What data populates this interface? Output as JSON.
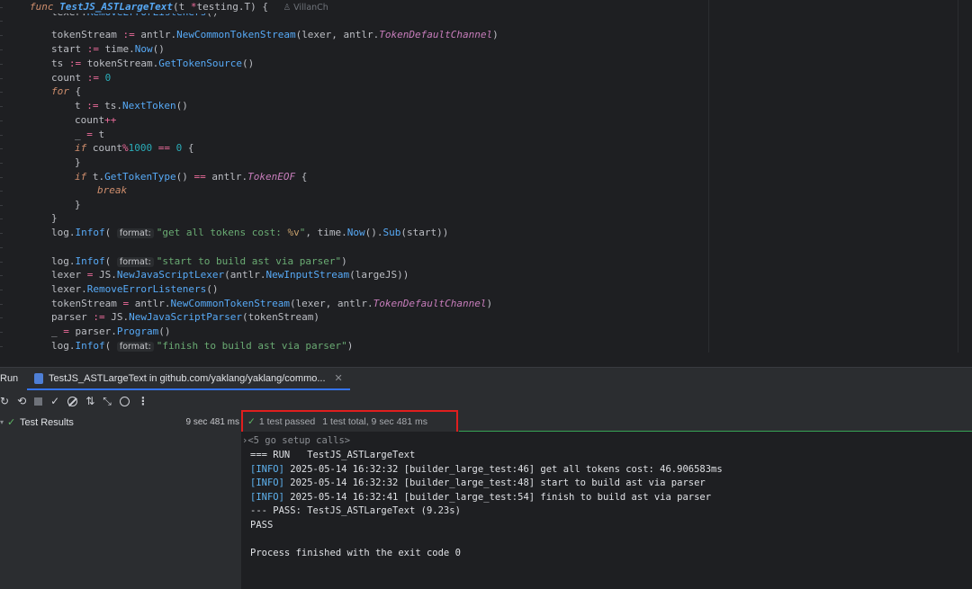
{
  "editor": {
    "lines": [
      {
        "parts": [
          [
            "kw",
            "func "
          ],
          [
            "fnd",
            "TestJS_ASTLargeText"
          ],
          [
            "brace",
            "("
          ],
          [
            "var",
            "t "
          ],
          [
            "op",
            "*"
          ],
          [
            "pkg",
            "testing"
          ],
          [
            "brace",
            "."
          ],
          [
            "ty",
            "T"
          ],
          [
            "brace",
            ") { "
          ]
        ],
        "author": "VillanCh"
      },
      {
        "parts": [
          [
            "var",
            "lexer."
          ],
          [
            "call",
            "RemoveErrorListeners"
          ],
          [
            "brace",
            "()"
          ]
        ]
      },
      {
        "parts": [
          [
            "var",
            "tokenStream "
          ],
          [
            "op",
            ":= "
          ],
          [
            "var",
            "antlr."
          ],
          [
            "call",
            "NewCommonTokenStream"
          ],
          [
            "brace",
            "("
          ],
          [
            "var",
            "lexer, antlr."
          ],
          [
            "tyi",
            "TokenDefaultChannel"
          ],
          [
            "brace",
            ")"
          ]
        ]
      },
      {
        "parts": [
          [
            "var",
            "start "
          ],
          [
            "op",
            ":= "
          ],
          [
            "var",
            "time."
          ],
          [
            "call",
            "Now"
          ],
          [
            "brace",
            "()"
          ]
        ]
      },
      {
        "parts": [
          [
            "var",
            "ts "
          ],
          [
            "op",
            ":= "
          ],
          [
            "var",
            "tokenStream."
          ],
          [
            "call",
            "GetTokenSource"
          ],
          [
            "brace",
            "()"
          ]
        ]
      },
      {
        "parts": [
          [
            "var",
            "count "
          ],
          [
            "op",
            ":= "
          ],
          [
            "num",
            "0"
          ]
        ]
      },
      {
        "parts": [
          [
            "kw",
            "for "
          ],
          [
            "brace",
            "{"
          ]
        ]
      },
      {
        "parts": [
          [
            "var",
            "t "
          ],
          [
            "op",
            ":= "
          ],
          [
            "var",
            "ts."
          ],
          [
            "call",
            "NextToken"
          ],
          [
            "brace",
            "()"
          ]
        ]
      },
      {
        "parts": [
          [
            "var",
            "count"
          ],
          [
            "op",
            "++"
          ]
        ]
      },
      {
        "parts": [
          [
            "var",
            "_ "
          ],
          [
            "op",
            "= "
          ],
          [
            "var",
            "t"
          ]
        ]
      },
      {
        "parts": [
          [
            "kw",
            "if "
          ],
          [
            "var",
            "count"
          ],
          [
            "op",
            "%"
          ],
          [
            "num",
            "1000 "
          ],
          [
            "op",
            "== "
          ],
          [
            "num",
            "0 "
          ],
          [
            "brace",
            "{"
          ]
        ]
      },
      {
        "parts": [
          [
            "brace",
            "}"
          ]
        ]
      },
      {
        "parts": [
          [
            "kw",
            "if "
          ],
          [
            "var",
            "t."
          ],
          [
            "call",
            "GetTokenType"
          ],
          [
            "brace",
            "() "
          ],
          [
            "op",
            "== "
          ],
          [
            "var",
            "antlr."
          ],
          [
            "tyi",
            "TokenEOF "
          ],
          [
            "brace",
            "{"
          ]
        ]
      },
      {
        "parts": [
          [
            "kw",
            "break"
          ]
        ]
      },
      {
        "parts": [
          [
            "brace",
            "}"
          ]
        ]
      },
      {
        "parts": [
          [
            "brace",
            "}"
          ]
        ]
      },
      {
        "parts": [
          [
            "var",
            "log."
          ],
          [
            "call",
            "Infof"
          ],
          [
            "brace",
            "( "
          ],
          [
            "hint",
            "format:"
          ],
          [
            "str",
            "\"get all tokens cost: "
          ],
          [
            "fmt",
            "%v"
          ],
          [
            "str",
            "\""
          ],
          [
            "brace",
            ", time."
          ],
          [
            "call",
            "Now"
          ],
          [
            "brace",
            "()."
          ],
          [
            "call",
            "Sub"
          ],
          [
            "brace",
            "(start))"
          ]
        ]
      },
      {
        "parts": []
      },
      {
        "parts": [
          [
            "var",
            "log."
          ],
          [
            "call",
            "Infof"
          ],
          [
            "brace",
            "( "
          ],
          [
            "hint",
            "format:"
          ],
          [
            "str",
            "\"start to build ast via parser\""
          ],
          [
            "brace",
            ")"
          ]
        ]
      },
      {
        "parts": [
          [
            "var",
            "lexer "
          ],
          [
            "op",
            "= "
          ],
          [
            "var",
            "JS."
          ],
          [
            "call",
            "NewJavaScriptLexer"
          ],
          [
            "brace",
            "(antlr."
          ],
          [
            "call",
            "NewInputStream"
          ],
          [
            "brace",
            "(largeJS))"
          ]
        ]
      },
      {
        "parts": [
          [
            "var",
            "lexer."
          ],
          [
            "call",
            "RemoveErrorListeners"
          ],
          [
            "brace",
            "()"
          ]
        ]
      },
      {
        "parts": [
          [
            "var",
            "tokenStream "
          ],
          [
            "op",
            "= "
          ],
          [
            "var",
            "antlr."
          ],
          [
            "call",
            "NewCommonTokenStream"
          ],
          [
            "brace",
            "(lexer, antlr."
          ],
          [
            "tyi",
            "TokenDefaultChannel"
          ],
          [
            "brace",
            ")"
          ]
        ]
      },
      {
        "parts": [
          [
            "var",
            "parser "
          ],
          [
            "op",
            ":= "
          ],
          [
            "var",
            "JS."
          ],
          [
            "call",
            "NewJavaScriptParser"
          ],
          [
            "brace",
            "(tokenStream)"
          ]
        ]
      },
      {
        "parts": [
          [
            "var",
            "_ "
          ],
          [
            "op",
            "= "
          ],
          [
            "var",
            "parser."
          ],
          [
            "call",
            "Program"
          ],
          [
            "brace",
            "()"
          ]
        ]
      },
      {
        "parts": [
          [
            "var",
            "log."
          ],
          [
            "call",
            "Infof"
          ],
          [
            "brace",
            "( "
          ],
          [
            "hint",
            "format:"
          ],
          [
            "str",
            "\"finish to build ast via parser\""
          ],
          [
            "brace",
            ")"
          ]
        ]
      }
    ]
  },
  "tool_tabs": {
    "run_label": "Run",
    "active_tab": "TestJS_ASTLargeText in github.com/yaklang/yaklang/commo..."
  },
  "tree": {
    "root_label": "Test Results",
    "root_duration": "9 sec 481 ms"
  },
  "status": {
    "passed": "1 test passed",
    "total": "1 test total, 9 sec 481 ms"
  },
  "console": {
    "setup": "<5 go setup calls>",
    "lines": [
      {
        "tag": "",
        "text": "=== RUN   TestJS_ASTLargeText"
      },
      {
        "tag": "[INFO]",
        "text": " 2025-05-14 16:32:32 [builder_large_test:46] get all tokens cost: 46.906583ms"
      },
      {
        "tag": "[INFO]",
        "text": " 2025-05-14 16:32:32 [builder_large_test:48] start to build ast via parser"
      },
      {
        "tag": "[INFO]",
        "text": " 2025-05-14 16:32:41 [builder_large_test:54] finish to build ast via parser"
      },
      {
        "tag": "",
        "text": "--- PASS: TestJS_ASTLargeText (9.23s)"
      },
      {
        "tag": "",
        "text": "PASS"
      },
      {
        "tag": "",
        "text": ""
      },
      {
        "tag": "",
        "text": "Process finished with the exit code 0"
      }
    ]
  }
}
